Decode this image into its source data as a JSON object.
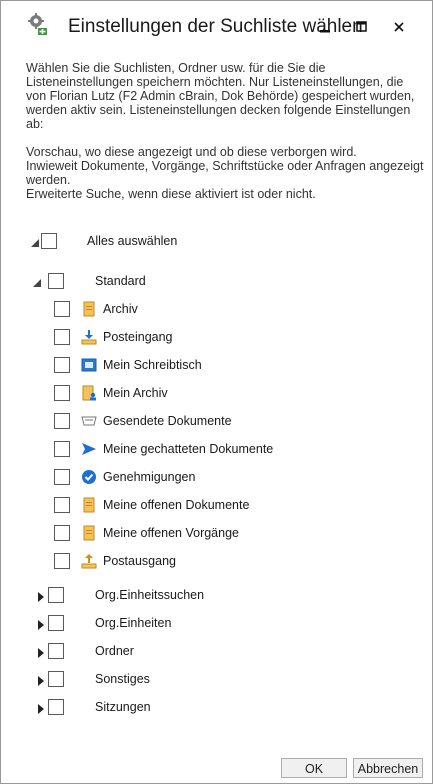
{
  "window": {
    "title": "Einstellungen der Suchliste wählen"
  },
  "description": {
    "para1": "Wählen Sie die Suchlisten, Ordner usw. für die Sie die Listeneinstellungen speichern möchten. Nur Listeneinstellungen, die von Florian Lutz (F2 Admin cBrain, Dok Behörde) gespeichert wurden, werden aktiv sein. Listeneinstellungen decken folgende Einstellungen ab:",
    "line1": "Vorschau, wo diese angezeigt und ob diese verborgen wird.",
    "line2": "Inwieweit Dokumente, Vorgänge, Schriftstücke oder Anfragen angezeigt werden.",
    "line3": "Erweiterte Suche, wenn diese aktiviert ist oder nicht."
  },
  "tree": {
    "select_all": "Alles auswählen",
    "standard": "Standard",
    "items": [
      {
        "label": "Archiv",
        "icon": "archive-icon"
      },
      {
        "label": "Posteingang",
        "icon": "inbox-icon"
      },
      {
        "label": "Mein Schreibtisch",
        "icon": "desk-icon"
      },
      {
        "label": "Mein Archiv",
        "icon": "my-archive-icon"
      },
      {
        "label": "Gesendete Dokumente",
        "icon": "sent-icon"
      },
      {
        "label": "Meine gechatteten Dokumente",
        "icon": "chat-arrow-icon"
      },
      {
        "label": "Genehmigungen",
        "icon": "approval-check-icon"
      },
      {
        "label": "Meine offenen Dokumente",
        "icon": "open-documents-icon"
      },
      {
        "label": "Meine offenen Vorgänge",
        "icon": "open-cases-icon"
      },
      {
        "label": "Postausgang",
        "icon": "outbox-icon"
      }
    ],
    "groups": [
      "Org.Einheitssuchen",
      "Org.Einheiten",
      "Ordner",
      "Sonstiges",
      "Sitzungen"
    ]
  },
  "buttons": {
    "ok": "OK",
    "cancel": "Abbrechen"
  },
  "colors": {
    "accent_blue": "#1f6fd1",
    "folder_yellow": "#f2c35a"
  }
}
